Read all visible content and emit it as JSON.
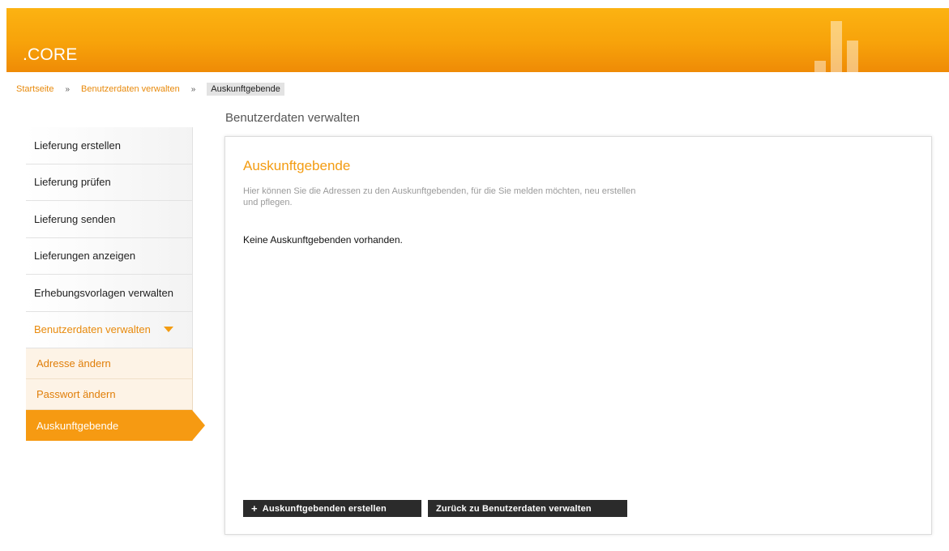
{
  "header": {
    "brand": ".CORE"
  },
  "breadcrumb": {
    "items": [
      {
        "label": "Startseite"
      },
      {
        "label": "Benutzerdaten verwalten"
      }
    ],
    "current": "Auskunftgebende",
    "separator": "»"
  },
  "page": {
    "title": "Benutzerdaten verwalten"
  },
  "sidebar": {
    "items": [
      {
        "label": "Lieferung erstellen"
      },
      {
        "label": "Lieferung prüfen"
      },
      {
        "label": "Lieferung senden"
      },
      {
        "label": "Lieferungen anzeigen"
      },
      {
        "label": "Erhebungsvorlagen verwalten"
      },
      {
        "label": "Benutzerdaten verwalten"
      }
    ],
    "subitems": [
      {
        "label": "Adresse ändern"
      },
      {
        "label": "Passwort ändern"
      },
      {
        "label": "Auskunftgebende"
      }
    ]
  },
  "panel": {
    "title": "Auskunftgebende",
    "description": "Hier können Sie die Adressen zu den Auskunftgebenden, für die Sie melden möchten, neu erstellen und pflegen.",
    "empty_text": "Keine Auskunftgebenden vorhanden.",
    "create_label": "Auskunftgebenden erstellen",
    "back_label": "Zurück zu Benutzerdaten verwalten"
  },
  "colors": {
    "accent": "#f39c12",
    "button": "#2b2b2b"
  },
  "icons": {
    "expand": "caret-down-icon",
    "add": "plus-icon"
  }
}
